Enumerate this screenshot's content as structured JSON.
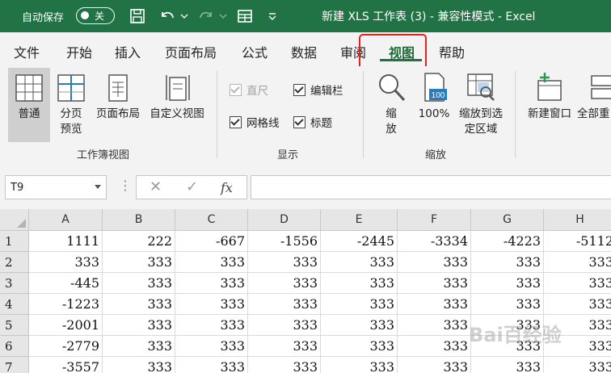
{
  "titlebar": {
    "autosave_label": "自动保存",
    "autosave_state": "关",
    "doc_title": "新建 XLS 工作表 (3)  -  兼容性模式  -  Excel",
    "accent": "#217346"
  },
  "tabs": [
    "文件",
    "开始",
    "插入",
    "页面布局",
    "公式",
    "数据",
    "审阅",
    "视图",
    "帮助"
  ],
  "active_tab": "视图",
  "ribbon": {
    "workbook_views": {
      "label": "工作簿视图",
      "normal": "普通",
      "page_break": "分页预览",
      "page_layout": "页面布局",
      "custom_views": "自定义视图"
    },
    "show": {
      "label": "显示",
      "ruler": "直尺",
      "formula_bar": "编辑栏",
      "gridlines": "网格线",
      "headings": "标题"
    },
    "zoom": {
      "label": "缩放",
      "zoom": "缩放",
      "zoom100": "100%",
      "zoom_icon_text": "100",
      "zoom_selection": "缩放到选定区域"
    },
    "window": {
      "new_window": "新建窗口",
      "arrange_all": "全部重"
    }
  },
  "formula_bar": {
    "name_box": "T9",
    "cancel": "✕",
    "enter": "✓",
    "fx": "fx",
    "value": ""
  },
  "grid": {
    "columns": [
      "A",
      "B",
      "C",
      "D",
      "E",
      "F",
      "G",
      "H"
    ],
    "rows": [
      {
        "num": "1",
        "cells": [
          "1111",
          "222",
          "-667",
          "-1556",
          "-2445",
          "-3334",
          "-4223",
          "-5112"
        ]
      },
      {
        "num": "2",
        "cells": [
          "333",
          "333",
          "333",
          "333",
          "333",
          "333",
          "333",
          "333"
        ]
      },
      {
        "num": "3",
        "cells": [
          "-445",
          "333",
          "333",
          "333",
          "333",
          "333",
          "333",
          "333"
        ]
      },
      {
        "num": "4",
        "cells": [
          "-1223",
          "333",
          "333",
          "333",
          "333",
          "333",
          "333",
          "333"
        ]
      },
      {
        "num": "5",
        "cells": [
          "-2001",
          "333",
          "333",
          "333",
          "333",
          "333",
          "333",
          "333"
        ]
      },
      {
        "num": "6",
        "cells": [
          "-2779",
          "333",
          "333",
          "333",
          "333",
          "333",
          "333",
          "333"
        ]
      },
      {
        "num": "7",
        "cells": [
          "-3557",
          "333",
          "333",
          "333",
          "333",
          "333",
          "333",
          "333"
        ]
      }
    ]
  },
  "watermark": "Bai百经验"
}
